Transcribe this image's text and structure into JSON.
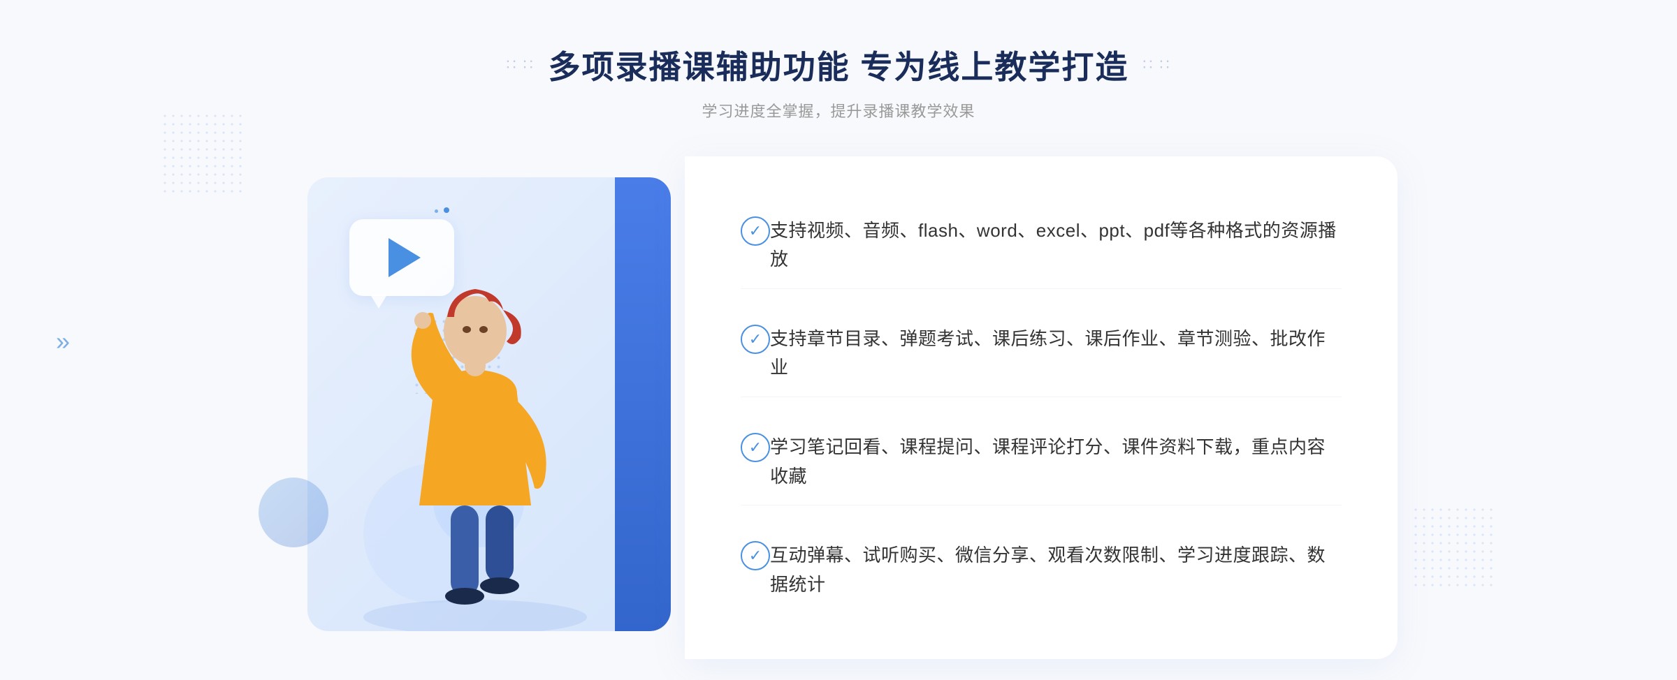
{
  "header": {
    "decoration_left": "⁚⁚",
    "decoration_right": "⁚⁚",
    "main_title": "多项录播课辅助功能 专为线上教学打造",
    "sub_title": "学习进度全掌握，提升录播课教学效果"
  },
  "features": [
    {
      "id": 1,
      "text": "支持视频、音频、flash、word、excel、ppt、pdf等各种格式的资源播放"
    },
    {
      "id": 2,
      "text": "支持章节目录、弹题考试、课后练习、课后作业、章节测验、批改作业"
    },
    {
      "id": 3,
      "text": "学习笔记回看、课程提问、课程评论打分、课件资料下载，重点内容收藏"
    },
    {
      "id": 4,
      "text": "互动弹幕、试听购买、微信分享、观看次数限制、学习进度跟踪、数据统计"
    }
  ],
  "colors": {
    "primary": "#4a90e2",
    "title": "#1a2d5a",
    "subtitle": "#999999",
    "text": "#333333",
    "border": "#f0f4fb",
    "bg_light": "#f8f9fc"
  }
}
